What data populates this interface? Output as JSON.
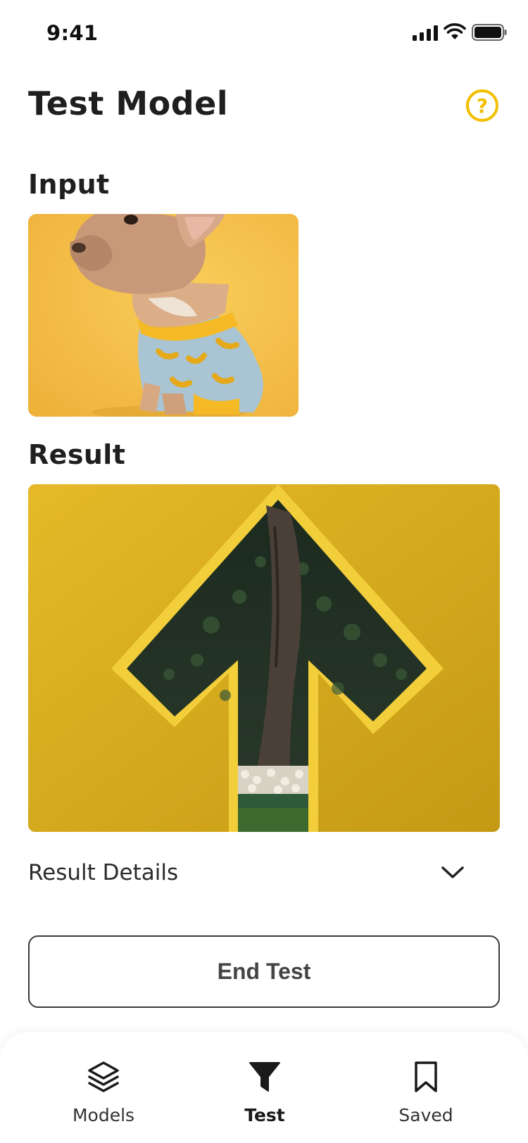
{
  "status_bar": {
    "time": "9:41"
  },
  "header": {
    "title": "Test Model",
    "help_icon": "question-circle-icon",
    "help_symbol": "?"
  },
  "input_section": {
    "label": "Input",
    "image": "puppy-in-banana-sweater-photo"
  },
  "result_section": {
    "label": "Result",
    "image": "arrow-cutout-wall-photo"
  },
  "details": {
    "label": "Result Details",
    "icon": "chevron-down-icon"
  },
  "actions": {
    "end_test_label": "End Test"
  },
  "tab_bar": {
    "items": [
      {
        "label": "Models",
        "icon": "layers-icon",
        "active": false
      },
      {
        "label": "Test",
        "icon": "filter-icon",
        "active": true
      },
      {
        "label": "Saved",
        "icon": "bookmark-icon",
        "active": false
      }
    ]
  },
  "colors": {
    "accent": "#f2bf00",
    "text": "#1f1f1f"
  }
}
